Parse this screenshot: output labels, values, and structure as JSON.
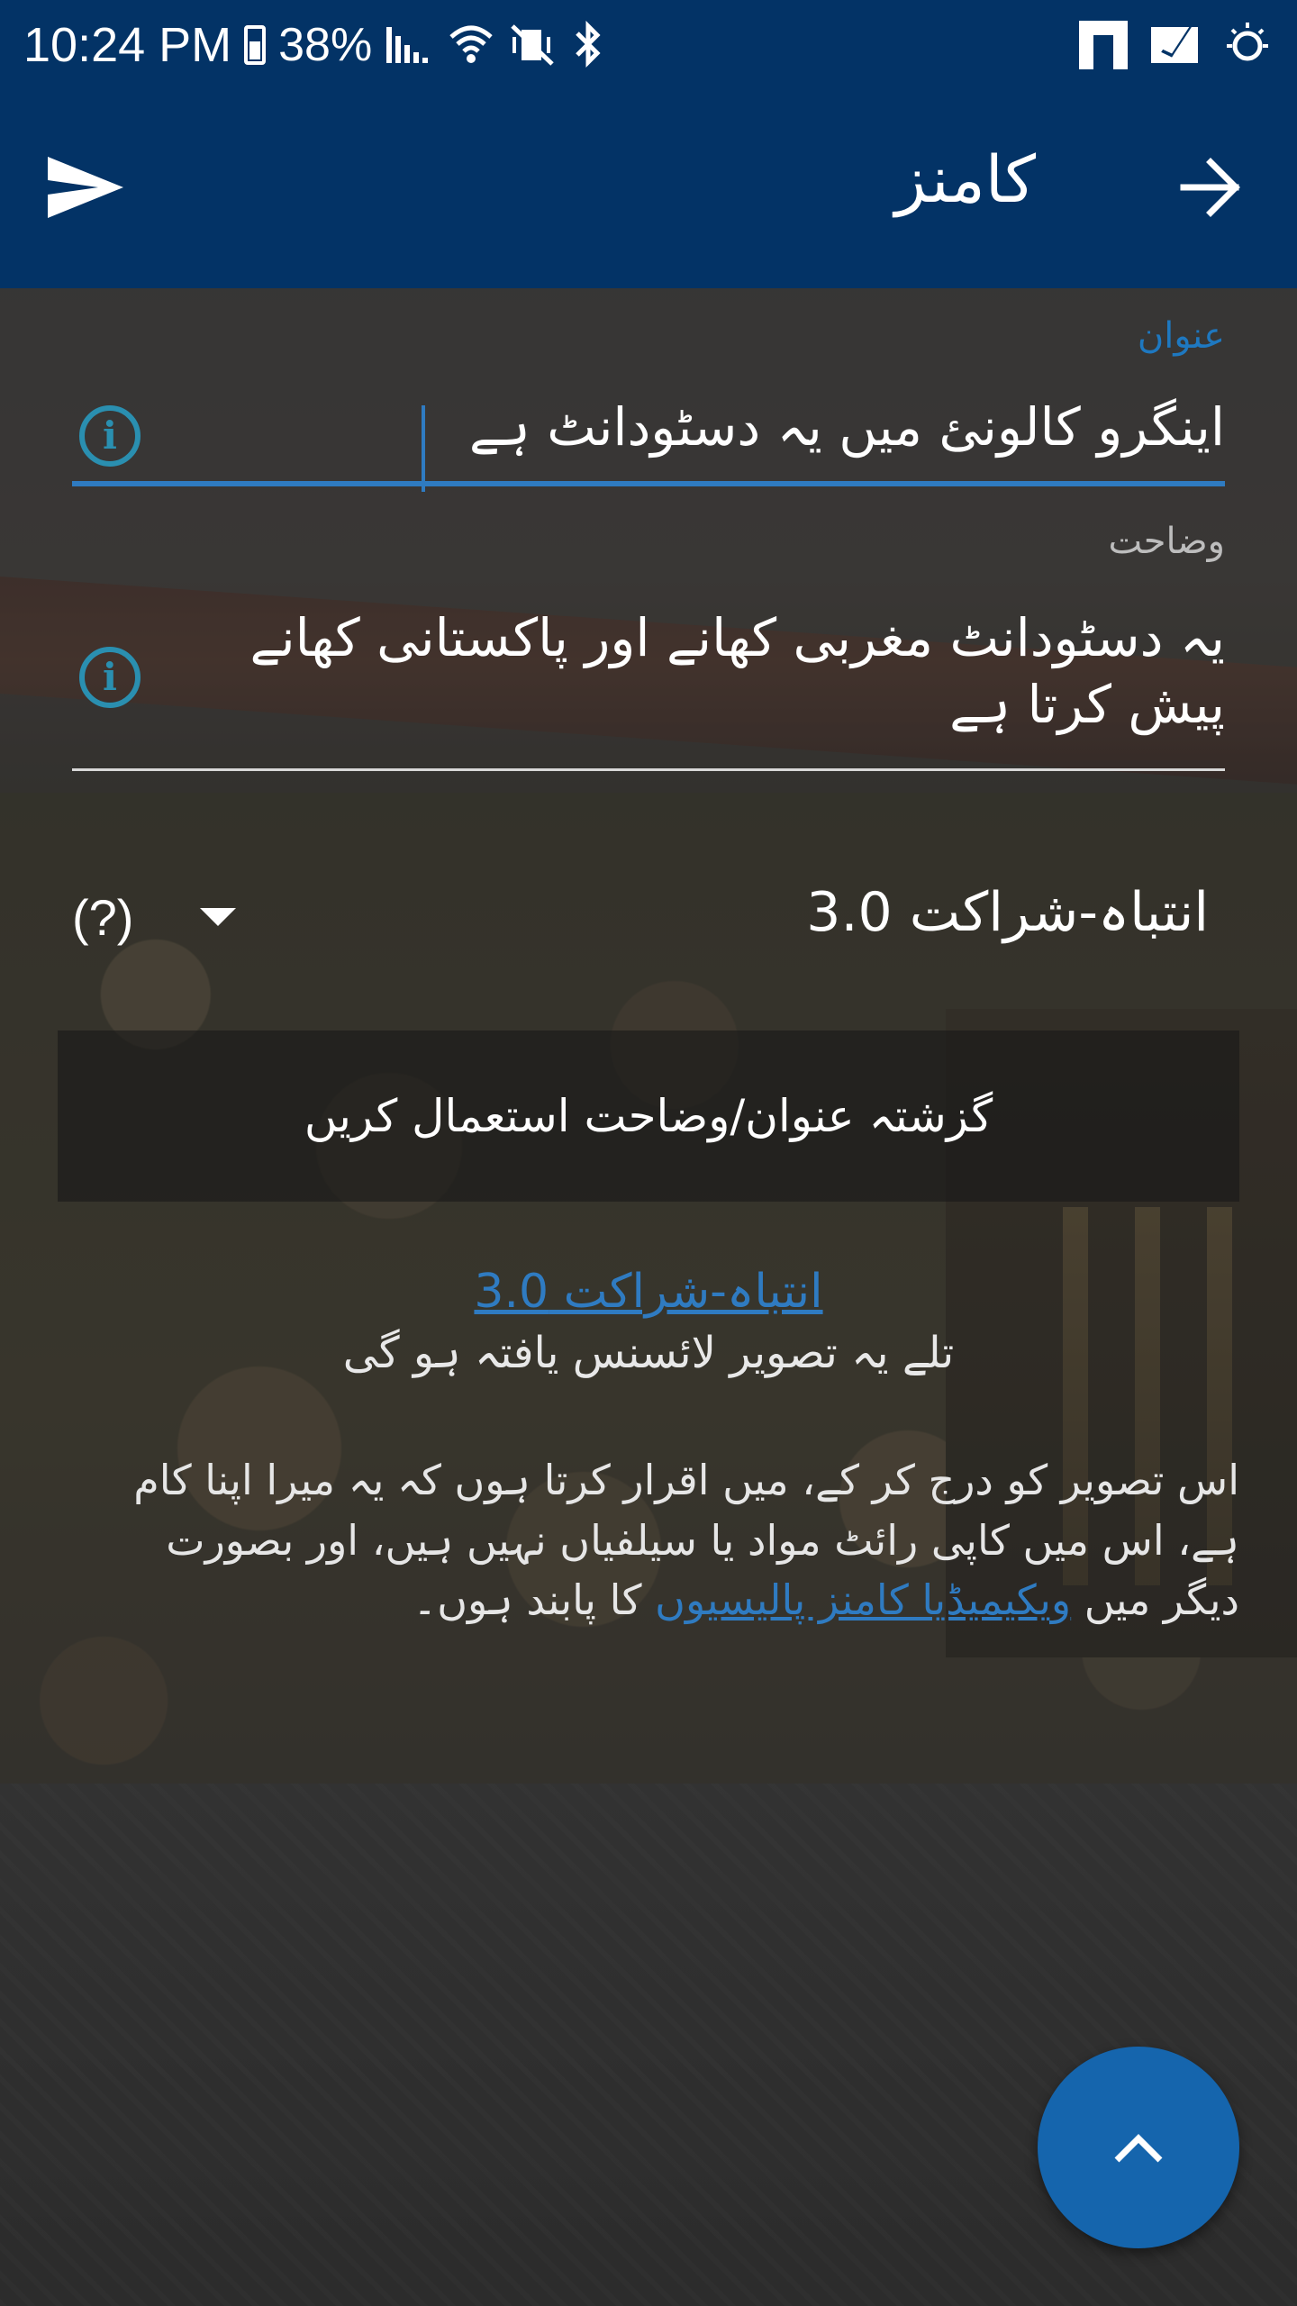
{
  "status_bar": {
    "time": "10:24 PM",
    "battery": "38%"
  },
  "app_bar": {
    "title": "کامنز",
    "send_icon": "send-icon",
    "forward_icon": "arrow-forward-icon"
  },
  "form": {
    "title_label": "عنوان",
    "title_value": "اینگرو کالونئ میں یہ دسٹودانٹ ہے",
    "description_label": "وضاحت",
    "description_value": "یہ دسٹودانٹ مغربی کھانے اور پاکستانی کھانے پیش کرتا ہے",
    "license_help": "(?)",
    "license_value": "انتباہ-شراکت 3.0",
    "previous_button": "گزشتہ عنوان/وضاحت استعمال کریں"
  },
  "license_notice": {
    "link_text": "انتباہ-شراکت 3.0",
    "line": "تلے یہ تصویر لائسنس یافتہ ہو گی"
  },
  "declaration": {
    "text_before": "اس تصویر کو درج کر کے، میں اقرار کرتا ہوں کہ یہ میرا اپنا کام ہے، اس میں کاپی رائٹ مواد یا سیلفیاں نہیں ہیں، اور بصورت دیگر میں ",
    "link_text": "ویکیمیڈیا کامنز پالیسیوں",
    "text_after": " کا پابند ہوں۔"
  },
  "colors": {
    "primary": "#033366",
    "accent": "#2f7bc1",
    "fab": "#1565ad",
    "info": "#2a8fb0"
  },
  "icons": {
    "fab": "chevron-up-icon",
    "info": "info-icon",
    "dropdown": "dropdown-arrow-icon"
  }
}
